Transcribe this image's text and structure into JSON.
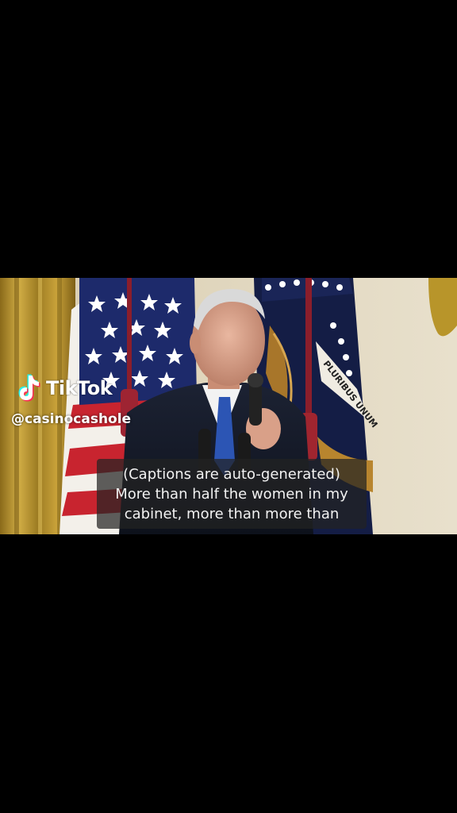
{
  "watermark": {
    "brand": "TikTok",
    "logo_icon": "tiktok-note-icon",
    "handle": "@casinocashole"
  },
  "captions": {
    "lines": [
      "(Captions are auto-generated)",
      "More than half the women in my",
      "cabinet, more than more than"
    ]
  },
  "flag_seal_text": "PLURIBUS UNUM",
  "colors": {
    "background": "#000000",
    "caption_bg": "#232323",
    "caption_text": "#f2f2f2",
    "tiktok_cyan": "#25f4ee",
    "tiktok_red": "#fe2c55",
    "flag_red": "#c8242f",
    "flag_blue": "#1d2a6b",
    "curtain_gold": "#b8952a"
  }
}
